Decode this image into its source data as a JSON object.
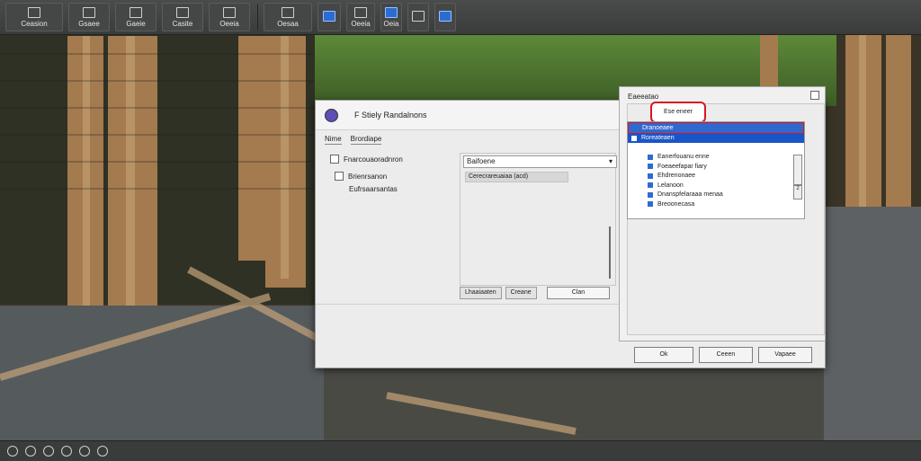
{
  "toolbar": {
    "items": [
      {
        "label": "",
        "icon": "file-icon"
      },
      {
        "label": "",
        "icon": "folder-icon"
      },
      {
        "label": "",
        "icon": "image-icon"
      },
      {
        "label": "",
        "icon": "layers-icon"
      },
      {
        "label": "",
        "icon": "adjust-icon"
      },
      {
        "label": "",
        "icon": "export-icon"
      },
      {
        "label": "",
        "icon": "settings-icon"
      }
    ],
    "labels": [
      "Ceasion",
      "Gsaee",
      "Gaeie",
      "Casite",
      "Oeeia",
      "Oesaa",
      "Oeeia"
    ],
    "right_labels": [
      "Oeia"
    ]
  },
  "dialog": {
    "title": "F Stiely Randalnons",
    "tabs": [
      "Nime",
      "Brordiape"
    ],
    "options": [
      {
        "label": "Fnarcouaoradnron",
        "checked": true
      },
      {
        "label": "Brienrsanon",
        "checked": false
      }
    ],
    "sub_label": "Eufrsaarsantas",
    "input_value": "Baifoene",
    "readout": "Cerecrareuaiaa (acd)",
    "inner_buttons": [
      "Lhaaiaaten",
      "Creane"
    ],
    "open_label": "Clan",
    "footer": {
      "ok": "Ok",
      "cancel": "Ceeen",
      "apply": "Vapaee"
    }
  },
  "right_panel": {
    "title": "Eaeeatao",
    "search_label": "Ese eneer",
    "tree": [
      {
        "label": "Dranoeaee",
        "state": "hl"
      },
      {
        "label": "Roreateaen",
        "state": "sel"
      },
      {
        "label": "",
        "state": ""
      },
      {
        "label": "Eanerfouanu enne",
        "state": ""
      },
      {
        "label": "Foeaeefapar fiary",
        "state": ""
      },
      {
        "label": "Ehdrenonaee",
        "state": ""
      },
      {
        "label": "Lelanoon",
        "state": ""
      },
      {
        "label": "Dnanspfelaraaa menaa",
        "state": ""
      },
      {
        "label": "Breoonecasa",
        "state": ""
      }
    ],
    "scroll_label": "2"
  },
  "bottom_bar": {
    "items": [
      "",
      "",
      "",
      "",
      "",
      ""
    ]
  },
  "colors": {
    "accent": "#1a55c8",
    "highlight": "#d9141f",
    "toolbar": "#3a3c3c"
  }
}
